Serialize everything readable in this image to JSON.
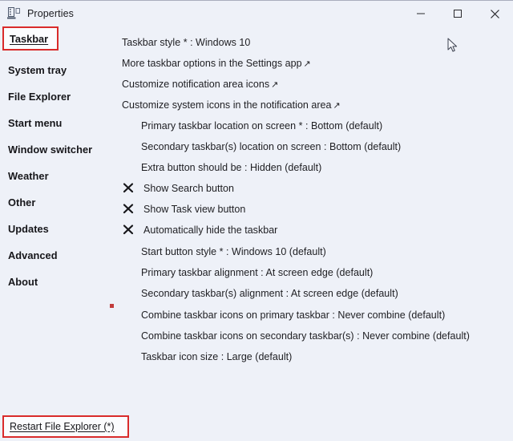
{
  "window": {
    "title": "Properties",
    "icon": "properties-taskbar-icon",
    "controls": [
      {
        "name": "minimize",
        "glyph": "minimize-icon"
      },
      {
        "name": "maximize",
        "glyph": "maximize-icon"
      },
      {
        "name": "close",
        "glyph": "close-icon"
      }
    ]
  },
  "colors": {
    "background": "#eef1f8",
    "highlight_border": "#d92b2b",
    "text": "#1e1e22",
    "marker": "#c23b3b"
  },
  "sidebar": {
    "active_item": "Taskbar",
    "items": [
      {
        "label": "Taskbar",
        "active": true
      },
      {
        "label": "System tray",
        "active": false
      },
      {
        "label": "File Explorer",
        "active": false
      },
      {
        "label": "Start menu",
        "active": false
      },
      {
        "label": "Window switcher",
        "active": false
      },
      {
        "label": "Weather",
        "active": false
      },
      {
        "label": "Other",
        "active": false
      },
      {
        "label": "Updates",
        "active": false
      },
      {
        "label": "Advanced",
        "active": false
      },
      {
        "label": "About",
        "active": false
      }
    ]
  },
  "main": {
    "rows": [
      {
        "text": "Taskbar style * : Windows 10",
        "style": "flush",
        "arrow": false
      },
      {
        "text": "More taskbar options in the Settings app",
        "style": "flush",
        "arrow": true
      },
      {
        "text": "Customize notification area icons",
        "style": "flush",
        "arrow": true
      },
      {
        "text": "Customize system icons in the notification area",
        "style": "flush",
        "arrow": true
      },
      {
        "text": "Primary taskbar location on screen * : Bottom (default)",
        "style": "indent",
        "arrow": false
      },
      {
        "text": "Secondary taskbar(s) location on screen : Bottom (default)",
        "style": "indent",
        "arrow": false
      },
      {
        "text": "Extra button should be : Hidden (default)",
        "style": "indent",
        "arrow": false
      },
      {
        "text": "Show Search button",
        "style": "check",
        "arrow": false
      },
      {
        "text": "Show Task view button",
        "style": "check",
        "arrow": false
      },
      {
        "text": "Automatically hide the taskbar",
        "style": "check",
        "arrow": false
      },
      {
        "text": "Start button style * : Windows 10 (default)",
        "style": "indent",
        "arrow": false
      },
      {
        "text": "Primary taskbar alignment : At screen edge (default)",
        "style": "indent",
        "arrow": false
      },
      {
        "text": "Secondary taskbar(s) alignment : At screen edge (default)",
        "style": "indent",
        "arrow": false
      },
      {
        "text": "Combine taskbar icons on primary taskbar : Never combine (default)",
        "style": "indent",
        "arrow": false
      },
      {
        "text": "Combine taskbar icons on secondary taskbar(s) : Never combine (default)",
        "style": "indent",
        "arrow": false
      },
      {
        "text": "Taskbar icon size : Large (default)",
        "style": "indent",
        "arrow": false
      }
    ],
    "arrow_glyph": "↗",
    "check_glyph": "x-mark-icon"
  },
  "footer": {
    "link_label": "Restart File Explorer (*)"
  }
}
